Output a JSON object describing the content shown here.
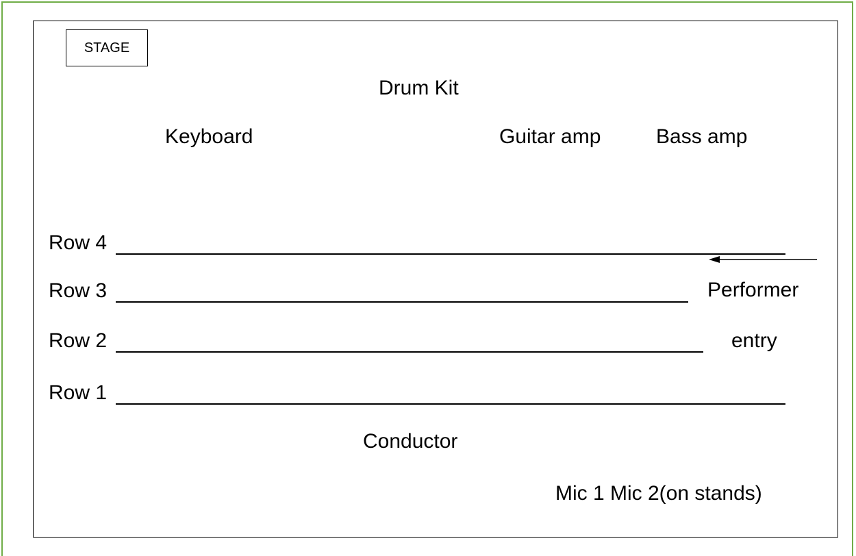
{
  "stage": {
    "label": "STAGE"
  },
  "instruments": {
    "drum_kit": "Drum Kit",
    "keyboard": "Keyboard",
    "guitar_amp": "Guitar amp",
    "bass_amp": "Bass amp"
  },
  "rows": [
    {
      "label": "Row 4"
    },
    {
      "label": "Row 3"
    },
    {
      "label": "Row 2"
    },
    {
      "label": "Row 1"
    }
  ],
  "entry": {
    "line1": "Performer",
    "line2": "entry"
  },
  "conductor": "Conductor",
  "mics": "Mic 1 Mic 2(on stands)"
}
